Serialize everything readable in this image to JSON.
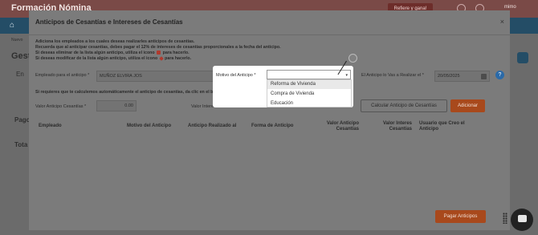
{
  "app": {
    "title": "Formación Nómina",
    "top_button": "Refiere y gana!",
    "user": "mimo",
    "side_texts": [
      "Gest",
      "Nuevo",
      "En",
      "Pago",
      "Tota"
    ]
  },
  "modal": {
    "title": "Anticipos de Cesantías e Intereses de Cesantías",
    "close": "×",
    "info": [
      "Adiciona los empleados a los cuales deseas realizarles anticipos de cesantías.",
      "Recuerda que al anticipar cesantías, debes pagar el 12% de intereses de cesantías proporcionales a la fecha del anticipo.",
      "Si deseas eliminar de la lista algún anticipo, utiliza el icono",
      "Si deseas modificar de la lista algún anticipo, utiliza el icono"
    ],
    "info_suffix": "para hacerlo.",
    "employee_label": "Empleado para el anticipo *",
    "employee_value": "MUÑOZ ELVIRA JOS",
    "reason_label": "Motivo del Anticipo *",
    "date_label": "El Anticipo lo Vas a Realizar el *",
    "date_value": "20/05/2025",
    "help": "?",
    "warning": "Si requieres que te calculemos automáticamente el anticipo de cesantías, da clic en el botón Calcular Anticipo... el valor del anticipo de forma manual.",
    "value_label": "Valor Anticipo Cesantías *",
    "value_input": "0.00",
    "interest_label": "Valor Intereses Cesantías",
    "calc_button": "Calcular Anticipo de Cesantías",
    "add_button": "Adicionar",
    "columns": [
      "Empleado",
      "Motivo del Anticipo",
      "Anticipo Realizado al",
      "Forma de Anticipo",
      "Valor Anticipo Cesantías",
      "Valor Interes Cesantías",
      "Usuario que Creo el Anticipo"
    ],
    "pay_button": "Pagar Anticipos"
  },
  "dropdown": {
    "options": [
      "Reforma de Vivienda",
      "Compra de Vivienda",
      "Educación"
    ],
    "highlighted": 0
  }
}
